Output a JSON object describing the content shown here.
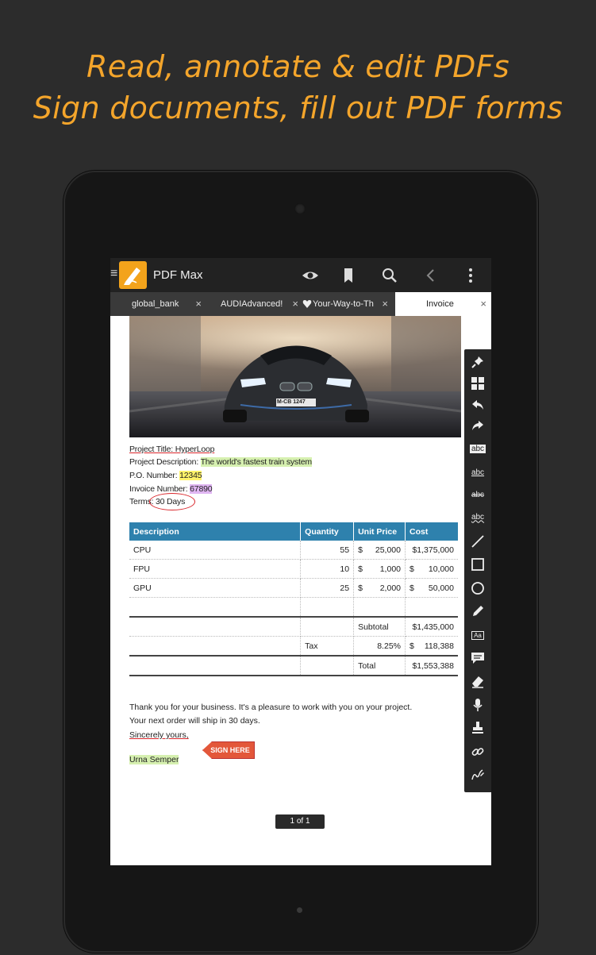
{
  "headline": {
    "line1": "Read, annotate & edit PDFs",
    "line2": "Sign documents, fill out PDF forms"
  },
  "app": {
    "title": "PDF Max",
    "actions": [
      "eye-icon",
      "bookmark-icon",
      "search-icon",
      "back-icon",
      "overflow-menu-icon"
    ]
  },
  "tabs": [
    {
      "label": "global_bank",
      "close": "×"
    },
    {
      "label": "AUDIAdvanced!",
      "close": "×"
    },
    {
      "label": "Your-Way-to-Th",
      "close": "×"
    },
    {
      "label": "Invoice",
      "close": "×"
    }
  ],
  "document": {
    "project_title_label": "Project Title: HyperLoop",
    "project_desc_label": "Project Description: ",
    "project_desc_value": "The world's fastest train system",
    "po_label": "P.O. Number: ",
    "po_value": "12345",
    "invoice_label": "Invoice Number: ",
    "invoice_value": "67890",
    "terms_label": "Terms: ",
    "terms_value": "30 Days",
    "table": {
      "headers": [
        "Description",
        "Quantity",
        "Unit Price",
        "Cost"
      ],
      "rows": [
        {
          "desc": "CPU",
          "qty": "55",
          "cur": "$",
          "price": "25,000",
          "cost": "$1,375,000"
        },
        {
          "desc": "FPU",
          "qty": "10",
          "cur": "$",
          "price": "1,000",
          "cost_cur": "$",
          "cost": "10,000"
        },
        {
          "desc": "GPU",
          "qty": "25",
          "cur": "$",
          "price": "2,000",
          "cost_cur": "$",
          "cost": "50,000"
        }
      ],
      "subtotal_label": "Subtotal",
      "subtotal_value": "$1,435,000",
      "tax_label": "Tax",
      "tax_rate": "8.25%",
      "tax_cur": "$",
      "tax_value": "118,388",
      "total_label": "Total",
      "total_value": "$1,553,388"
    },
    "thanks_line1": "Thank you for your business. It's a pleasure to work with you on your project.",
    "thanks_line2": "Your next order will ship in 30 days.",
    "sincerely": "Sincerely yours,",
    "sign_here": "SIGN HERE",
    "signer": "Urna Semper",
    "page_indicator": "1 of 1",
    "license_plate": "M-CB 1247"
  },
  "toolbar": {
    "tools": [
      "pin-icon",
      "grid-icon",
      "undo-icon",
      "redo-icon",
      "highlight-text-icon",
      "underline-text-icon",
      "strikeout-text-icon",
      "squiggly-text-icon",
      "line-icon",
      "rectangle-icon",
      "circle-icon",
      "pen-icon",
      "text-box-icon",
      "note-icon",
      "eraser-icon",
      "microphone-icon",
      "stamp-icon",
      "link-icon",
      "signature-icon"
    ],
    "abc_label": "abc",
    "aa_label": "Aa"
  },
  "colors": {
    "accent": "#f4a52b",
    "table_header": "#2e81ad",
    "highlight_green": "#d6f0b0",
    "highlight_yellow": "#fff36a",
    "highlight_purple": "#e0b6f2",
    "annotation_red": "#d9262b"
  }
}
